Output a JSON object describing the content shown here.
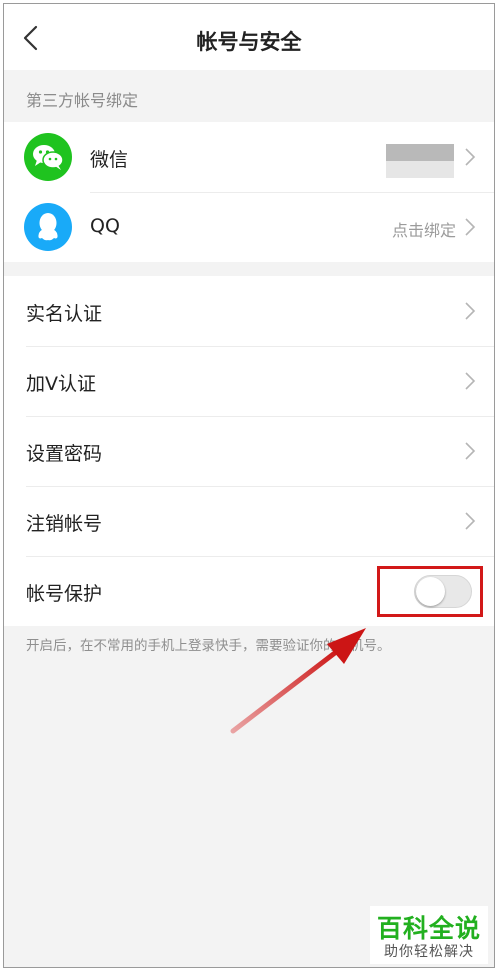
{
  "header": {
    "title": "帐号与安全"
  },
  "bind_section": {
    "title": "第三方帐号绑定",
    "items": [
      {
        "label": "微信",
        "icon": "wechat-icon",
        "value": ""
      },
      {
        "label": "QQ",
        "icon": "qq-icon",
        "value": "点击绑定"
      }
    ]
  },
  "menu": {
    "items": [
      {
        "label": "实名认证"
      },
      {
        "label": "加V认证"
      },
      {
        "label": "设置密码"
      },
      {
        "label": "注销帐号"
      },
      {
        "label": "帐号保护",
        "toggle": false
      }
    ],
    "protection_note": "开启后，在不常用的手机上登录快手，需要验证你的手机号。"
  },
  "watermark": {
    "title": "百科全说",
    "subtitle": "助你轻松解决"
  },
  "colors": {
    "wechat": "#1fc31f",
    "qq": "#19aaf8",
    "annotation": "#d21818",
    "watermark": "#22b01f"
  }
}
